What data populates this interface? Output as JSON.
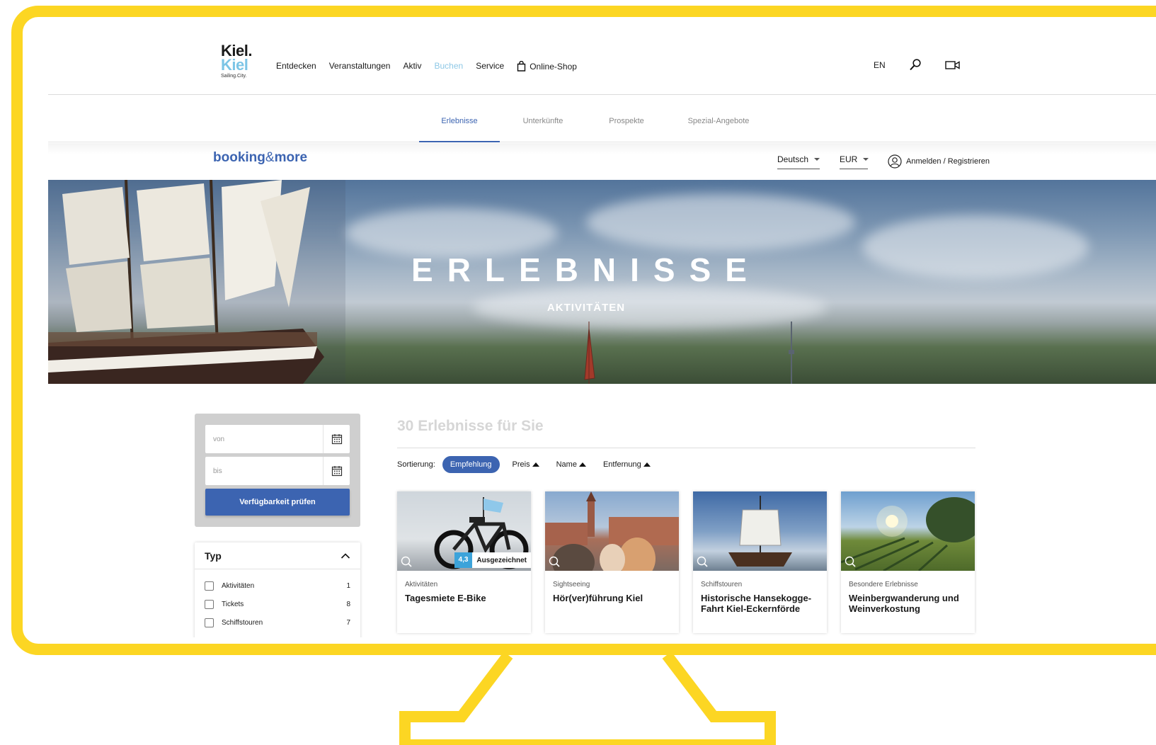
{
  "header": {
    "logo": {
      "line1": "Kiel.",
      "line2": "Kiel",
      "tagline": "Sailing.City."
    },
    "menu": [
      {
        "label": "Entdecken",
        "active": false
      },
      {
        "label": "Veranstaltungen",
        "active": false
      },
      {
        "label": "Aktiv",
        "active": false
      },
      {
        "label": "Buchen",
        "active": true
      },
      {
        "label": "Service",
        "active": false
      }
    ],
    "shop_label": "Online-Shop",
    "lang_label": "EN",
    "search_icon": "search-icon",
    "video_icon": "video-camera-icon"
  },
  "subtabs": [
    {
      "label": "Erlebnisse",
      "active": true
    },
    {
      "label": "Unterkünfte",
      "active": false
    },
    {
      "label": "Prospekte",
      "active": false
    },
    {
      "label": "Spezial-Angebote",
      "active": false
    }
  ],
  "booking": {
    "brand_left": "booking",
    "brand_amp": "&",
    "brand_right": "more",
    "language": "Deutsch",
    "currency": "EUR",
    "login_label": "Anmelden / Registrieren"
  },
  "hero": {
    "title": "ERLEBNISSE",
    "subtitle": "AKTIVITÄTEN"
  },
  "filters": {
    "from_placeholder": "von",
    "to_placeholder": "bis",
    "check_label": "Verfügbarkeit prüfen",
    "type_heading": "Typ",
    "types": [
      {
        "label": "Aktivitäten",
        "count": "1"
      },
      {
        "label": "Tickets",
        "count": "8"
      },
      {
        "label": "Schiffstouren",
        "count": "7"
      }
    ]
  },
  "results": {
    "title": "30 Erlebnisse für Sie",
    "sort_label": "Sortierung:",
    "sort_options": [
      {
        "label": "Empfehlung",
        "active": true
      },
      {
        "label": "Preis",
        "active": false
      },
      {
        "label": "Name",
        "active": false
      },
      {
        "label": "Entfernung",
        "active": false
      }
    ],
    "cards": [
      {
        "category": "Aktivitäten",
        "title": "Tagesmiete E-Bike",
        "rating": "4,3",
        "badge": "Ausgezeichnet"
      },
      {
        "category": "Sightseeing",
        "title": "Hör(ver)führung Kiel"
      },
      {
        "category": "Schiffstouren",
        "title": "Historische Hansekogge-Fahrt Kiel-Eckernförde"
      },
      {
        "category": "Besondere Erlebnisse",
        "title": "Weinbergwanderung und Weinverkostung"
      }
    ]
  },
  "colors": {
    "frame": "#fcd623",
    "primary": "#3c64b1",
    "menu_active": "#8ec8e6",
    "rating": "#3ca3da"
  }
}
